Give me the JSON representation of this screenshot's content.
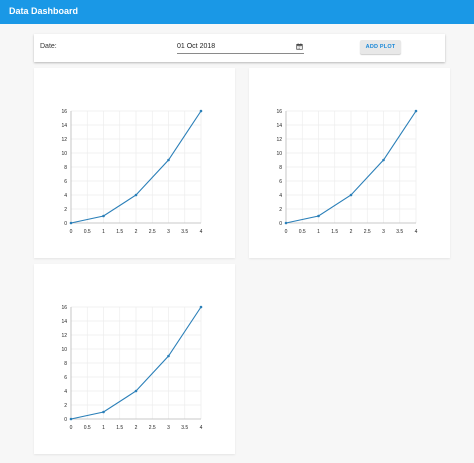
{
  "app": {
    "title": "Data Dashboard"
  },
  "controls": {
    "date_label": "Date:",
    "date_value": "01 Oct 2018",
    "add_button_label": "ADD PLOT"
  },
  "colors": {
    "appbar": "#1a98e6",
    "series": "#2a7fb8",
    "grid": "#ececec"
  },
  "chart_data": [
    {
      "type": "line",
      "x": [
        0,
        1,
        2,
        3,
        4
      ],
      "y": [
        0,
        1,
        4,
        9,
        16
      ],
      "xticks": [
        "0",
        "0.5",
        "1",
        "1.5",
        "2",
        "2.5",
        "3",
        "3.5",
        "4"
      ],
      "yticks": [
        "0",
        "2",
        "4",
        "6",
        "8",
        "10",
        "12",
        "14",
        "16"
      ],
      "xlim": [
        0,
        4
      ],
      "ylim": [
        0,
        16
      ],
      "grid": true
    },
    {
      "type": "line",
      "x": [
        0,
        1,
        2,
        3,
        4
      ],
      "y": [
        0,
        1,
        4,
        9,
        16
      ],
      "xticks": [
        "0",
        "0.5",
        "1",
        "1.5",
        "2",
        "2.5",
        "3",
        "3.5",
        "4"
      ],
      "yticks": [
        "0",
        "2",
        "4",
        "6",
        "8",
        "10",
        "12",
        "14",
        "16"
      ],
      "xlim": [
        0,
        4
      ],
      "ylim": [
        0,
        16
      ],
      "grid": true
    },
    {
      "type": "line",
      "x": [
        0,
        1,
        2,
        3,
        4
      ],
      "y": [
        0,
        1,
        4,
        9,
        16
      ],
      "xticks": [
        "0",
        "0.5",
        "1",
        "1.5",
        "2",
        "2.5",
        "3",
        "3.5",
        "4"
      ],
      "yticks": [
        "0",
        "2",
        "4",
        "6",
        "8",
        "10",
        "12",
        "14",
        "16"
      ],
      "xlim": [
        0,
        4
      ],
      "ylim": [
        0,
        16
      ],
      "grid": true
    }
  ]
}
